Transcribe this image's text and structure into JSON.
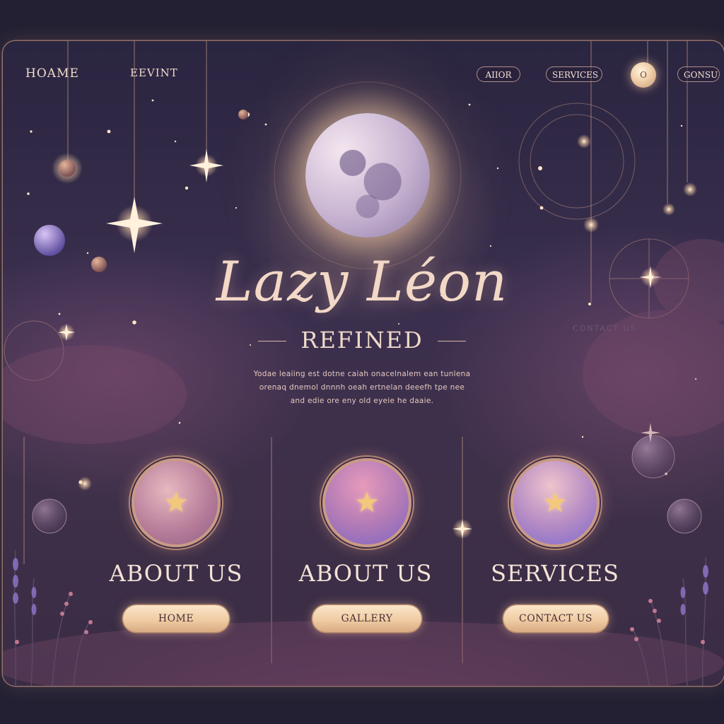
{
  "nav": {
    "left_links": [
      "HOAME",
      "EEVINT"
    ],
    "right_pills": [
      "AIIOR",
      "SERVICES",
      "GONSU"
    ],
    "orb_label": "O"
  },
  "hero": {
    "title": "Lazy Léon",
    "subtitle": "REFINED",
    "tagline": [
      "Yodae leaiing est dotne caiah onacelnalem ean tunlena",
      "orenaq dnemol dnnnh oeah ertnelan deeefh tpe nee",
      "and edie ore eny old eyeie he daaie."
    ],
    "faint_text": "CONTACT US"
  },
  "features": [
    {
      "label": "ABOUT US",
      "icon": "star-icon"
    },
    {
      "label": "ABOUT US",
      "icon": "star-icon"
    },
    {
      "label": "SERVICES",
      "icon": "star-icon"
    }
  ],
  "buttons": [
    "HOME",
    "GALLERY",
    "CONTACT US"
  ],
  "colors": {
    "background": "#232033",
    "panel": "#3a2f4e",
    "accent_gold": "#f3c87a",
    "text_cream": "#f2d8c6",
    "border_rose": "#c99a86"
  }
}
